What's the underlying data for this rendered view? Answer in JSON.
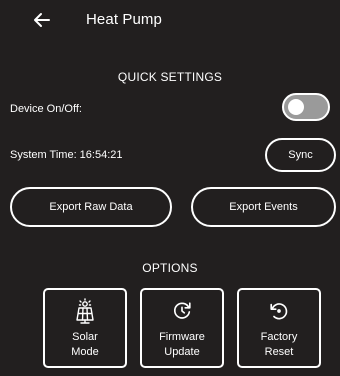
{
  "header": {
    "title": "Heat Pump",
    "back_icon": "back-arrow-icon"
  },
  "quick_settings": {
    "title": "QUICK SETTINGS",
    "device_label": "Device On/Off:",
    "device_on": false,
    "system_time_label": "System Time: 16:54:21",
    "sync_label": "Sync",
    "export_raw_label": "Export Raw Data",
    "export_events_label": "Export Events"
  },
  "options": {
    "title": "OPTIONS",
    "tiles": [
      {
        "line1": "Solar",
        "line2": "Mode",
        "icon": "solar-panel-icon"
      },
      {
        "line1": "Firmware",
        "line2": "Update",
        "icon": "firmware-update-icon"
      },
      {
        "line1": "Factory",
        "line2": "Reset",
        "icon": "factory-reset-icon"
      }
    ]
  },
  "colors": {
    "background": "#221f1f",
    "foreground": "#ffffff",
    "toggle_track": "#9a9a9a"
  }
}
